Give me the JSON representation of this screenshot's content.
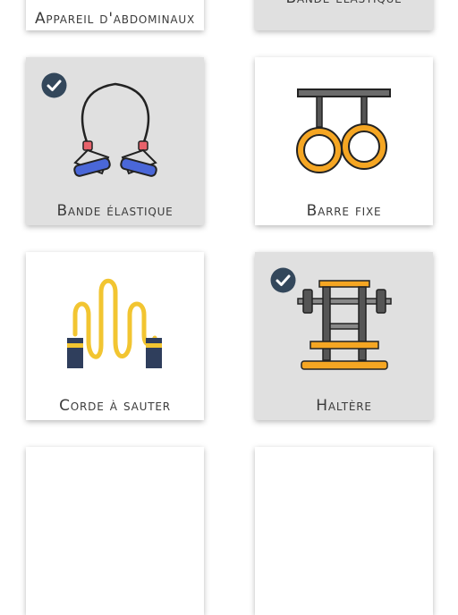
{
  "equipment": [
    {
      "label": "Appareil d'abdominaux",
      "selected": false,
      "icon": "ab-machine-icon"
    },
    {
      "label": "Bande élastique",
      "selected": true,
      "icon": "resistance-band-icon"
    },
    {
      "label": "Bande élastique",
      "selected": true,
      "icon": "resistance-band-icon"
    },
    {
      "label": "Barre fixe",
      "selected": false,
      "icon": "gymnastic-rings-icon"
    },
    {
      "label": "Corde à sauter",
      "selected": false,
      "icon": "jump-rope-icon"
    },
    {
      "label": "Haltère",
      "selected": true,
      "icon": "barbell-rack-icon"
    },
    {
      "label": "",
      "selected": false,
      "icon": ""
    },
    {
      "label": "",
      "selected": false,
      "icon": ""
    }
  ],
  "colors": {
    "selected_bg": "#e0e0e0",
    "check": "#33475b",
    "orange": "#f5a623",
    "yellow": "#f2c531",
    "navy": "#2f3e5c",
    "band_blue": "#4a67d8",
    "band_red": "#e8626b"
  }
}
